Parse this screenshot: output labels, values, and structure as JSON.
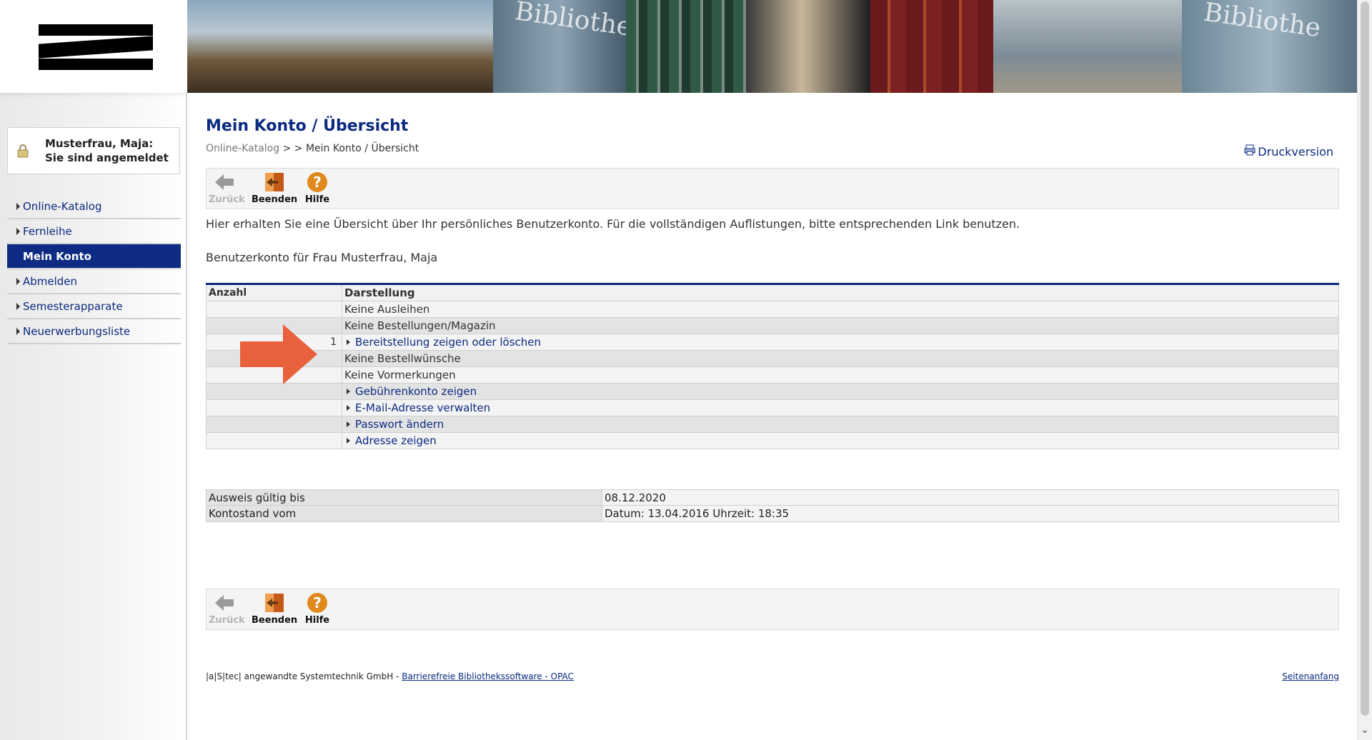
{
  "user": {
    "status_text": "Musterfrau, Maja: Sie sind angemeldet"
  },
  "sidebar": {
    "items": [
      {
        "label": "Online-Katalog",
        "active": false
      },
      {
        "label": "Fernleihe",
        "active": false
      },
      {
        "label": "Mein Konto",
        "active": true
      },
      {
        "label": "Abmelden",
        "active": false
      },
      {
        "label": "Semesterapparate",
        "active": false
      },
      {
        "label": "Neuerwerbungsliste",
        "active": false
      }
    ]
  },
  "banner": {
    "words": [
      "Bibliothek",
      "Bibliothe"
    ]
  },
  "page": {
    "title": "Mein Konto / Übersicht",
    "breadcrumb_link": "Online-Katalog",
    "breadcrumb_sep": " > > ",
    "breadcrumb_current": "Mein Konto / Übersicht",
    "print_label": "Druckversion",
    "intro": "Hier erhalten Sie eine Übersicht über Ihr persönliches Benutzerkonto. Für die vollständigen Auflistungen, bitte entsprechenden Link benutzen.",
    "account_line": "Benutzerkonto für Frau Musterfrau, Maja"
  },
  "toolbar": {
    "back_label": "Zurück",
    "exit_label": "Beenden",
    "help_label": "Hilfe"
  },
  "overview_table": {
    "headers": {
      "count": "Anzahl",
      "display": "Darstellung"
    },
    "rows": [
      {
        "count": "",
        "text": "Keine Ausleihen",
        "is_link": false
      },
      {
        "count": "",
        "text": "Keine Bestellungen/Magazin",
        "is_link": false
      },
      {
        "count": "1",
        "text": "Bereitstellung zeigen oder löschen",
        "is_link": true
      },
      {
        "count": "",
        "text": "Keine Bestellwünsche",
        "is_link": false
      },
      {
        "count": "",
        "text": "Keine Vormerkungen",
        "is_link": false
      },
      {
        "count": "",
        "text": "Gebührenkonto zeigen",
        "is_link": true
      },
      {
        "count": "",
        "text": "E-Mail-Adresse verwalten",
        "is_link": true
      },
      {
        "count": "",
        "text": "Passwort ändern",
        "is_link": true
      },
      {
        "count": "",
        "text": "Adresse zeigen",
        "is_link": true
      }
    ]
  },
  "info_table": {
    "rows": [
      {
        "label": "Ausweis gültig bis",
        "value": "08.12.2020"
      },
      {
        "label": "Kontostand vom",
        "value": "Datum: 13.04.2016 Uhrzeit: 18:35"
      }
    ]
  },
  "footer": {
    "company": "|a|S|tec| angewandte Systemtechnik GmbH - ",
    "company_link": "Barrierefreie Bibliothekssoftware - OPAC",
    "top_link": "Seitenanfang"
  },
  "colors": {
    "brand_blue": "#0d2b82",
    "arrow_orange": "#e8603c",
    "help_orange": "#e08a1e"
  }
}
